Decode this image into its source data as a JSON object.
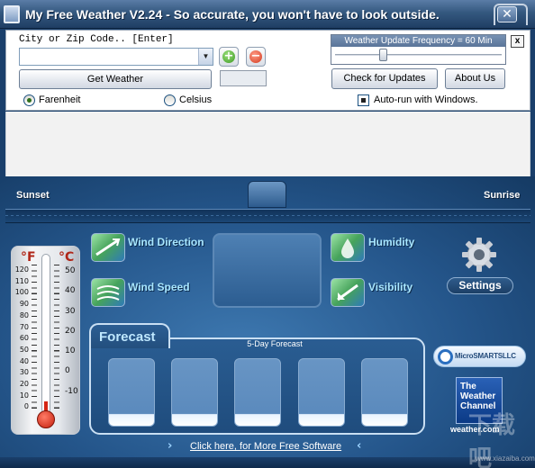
{
  "window": {
    "title": "My Free Weather V2.24 -  So accurate, you won't have to look outside.",
    "close_glyph": "✕"
  },
  "controls": {
    "city_label": "City or Zip Code..  [Enter]",
    "city_value": "",
    "add_glyph": "+",
    "remove_glyph": "−",
    "get_weather_label": "Get Weather",
    "frequency_label": "Weather Update Frequency = 60 Min",
    "frequency_value": 60,
    "frequency_slider_fraction": 0.28,
    "close_panel_label": "x",
    "check_updates_label": "Check for Updates",
    "about_label": "About Us",
    "farenheit_label": "Farenheit",
    "celsius_label": "Celsius",
    "unit_selected": "Farenheit",
    "autorun_label": "Auto-run with Windows.",
    "autorun_checked": true
  },
  "dashboard": {
    "sunset_label": "Sunset",
    "sunrise_label": "Sunrise",
    "wind_direction_label": "Wind Direction",
    "wind_speed_label": "Wind Speed",
    "humidity_label": "Humidity",
    "visibility_label": "Visibility",
    "settings_label": "Settings"
  },
  "thermometer": {
    "f_unit": "°F",
    "c_unit": "°C",
    "f_scale": [
      "120",
      "110",
      "100",
      "90",
      "80",
      "70",
      "60",
      "50",
      "40",
      "30",
      "20",
      "10",
      "0"
    ],
    "c_scale": [
      "50",
      "40",
      "30",
      "20",
      "10",
      "0",
      "-10"
    ]
  },
  "forecast": {
    "title": "Forecast",
    "subtitle": "5-Day Forecast",
    "day_count": 5
  },
  "brands": {
    "microsmarts": "MicroSMARTSLLC",
    "twc_line1": "The",
    "twc_line2": "Weather",
    "twc_line3": "Channel",
    "twc_url": "weather.com"
  },
  "footer": {
    "link_label": "Click here, for More Free Software",
    "left_chevron": "›",
    "right_chevron": "‹"
  },
  "watermark": {
    "text": "下载吧",
    "url": "www.xiazaiba.com"
  },
  "colors": {
    "titlebar": "#34587f",
    "dashboard_blue": "#24558a",
    "metric_label": "#a9e7ff",
    "thermometer_red": "#d52614"
  }
}
